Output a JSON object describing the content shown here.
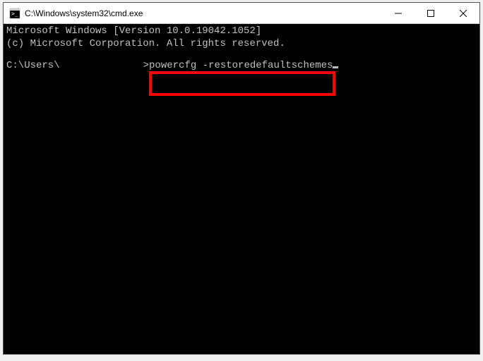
{
  "window": {
    "title": "C:\\Windows\\system32\\cmd.exe"
  },
  "terminal": {
    "line1": "Microsoft Windows [Version 10.0.19042.1052]",
    "line2": "(c) Microsoft Corporation. All rights reserved.",
    "prompt_prefix": "C:\\Users\\",
    "prompt_suffix": ">",
    "command": "powercfg -restoredefaultschemes"
  }
}
